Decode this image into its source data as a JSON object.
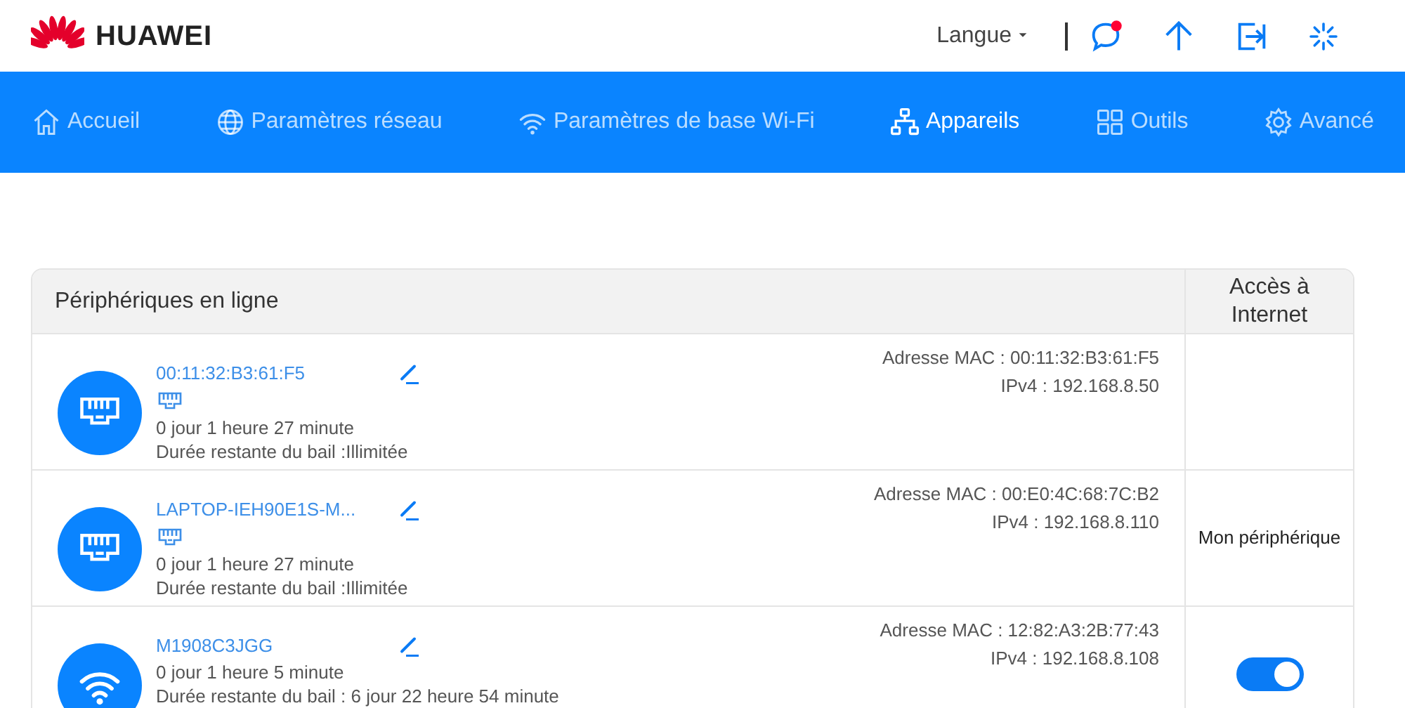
{
  "header": {
    "brand": "HUAWEI",
    "language": "Langue",
    "notification": true
  },
  "nav": [
    {
      "label": "Accueil",
      "kind": "home",
      "selected": false
    },
    {
      "label": "Paramètres réseau",
      "kind": "globe",
      "selected": false
    },
    {
      "label": "Paramètres de base Wi-Fi",
      "kind": "wifi",
      "selected": false
    },
    {
      "label": "Appareils",
      "kind": "devices",
      "selected": true
    },
    {
      "label": "Outils",
      "kind": "tools",
      "selected": false
    },
    {
      "label": "Avancé",
      "kind": "gear",
      "selected": false
    }
  ],
  "table": {
    "columns": [
      "Périphériques en ligne",
      "Accès à Internet"
    ],
    "rows": [
      {
        "kind": "wired",
        "name": "00:11:32:B3:61:F5",
        "duration": "0 jour 1 heure 27 minute",
        "lease": "Durée restante du bail :Illimitée",
        "mac": "Adresse MAC : 00:11:32:B3:61:F5",
        "ipv4": "IPv4 : 192.168.8.50"
      },
      {
        "kind": "wired",
        "name": "LAPTOP-IEH90E1S-M...",
        "duration": "0 jour 1 heure 27 minute",
        "lease": "Durée restante du bail :Illimitée",
        "mac": "Adresse MAC : 00:E0:4C:68:7C:B2",
        "ipv4": "IPv4 : 192.168.8.110",
        "access": {
          "kind": "text",
          "text": "Mon périphérique"
        }
      },
      {
        "kind": "wifi",
        "name": "M1908C3JGG",
        "duration": "0 jour 1 heure 5 minute",
        "lease": "Durée restante du bail : 6 jour 22 heure 54 minute",
        "mac": "Adresse MAC : 12:82:A3:2B:77:43",
        "ipv4": "IPv4 : 192.168.8.108",
        "access": {
          "kind": "toggle",
          "on": true
        }
      }
    ]
  }
}
